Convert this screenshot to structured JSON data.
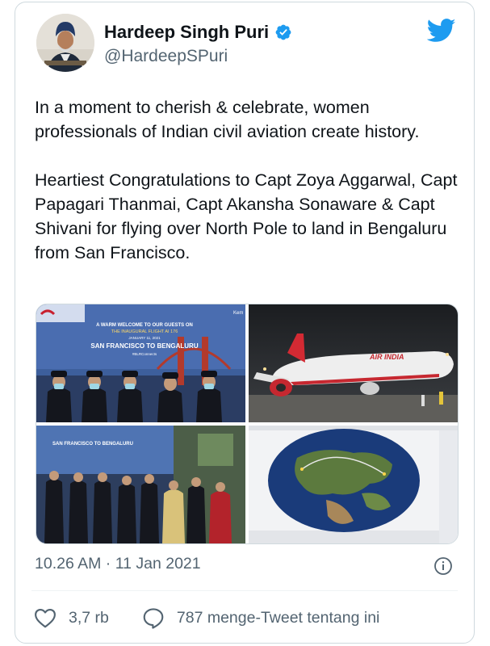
{
  "author": {
    "name": "Hardeep Singh Puri",
    "handle": "@HardeepSPuri"
  },
  "tweet": {
    "paragraph1": "In a moment to cherish & celebrate, women professionals of Indian civil aviation create history.",
    "paragraph2": "Heartiest Congratulations to Capt Zoya Aggarwal, Capt Papagari Thanmai, Capt Akansha Sonaware & Capt Shivani for flying over North Pole to land in Bengaluru from San Francisco."
  },
  "media": {
    "photo1": {
      "banner_line1": "A WARM WELCOME TO OUR GUESTS ON",
      "banner_line2": "THE INAUGURAL FLIGHT AI 176",
      "banner_date": "JANUARY 11, 2021",
      "banner_route": "SAN FRANCISCO TO BENGALURU",
      "banner_hashtag": "#BLRConnects",
      "corner_text": "Kem"
    },
    "photo2": {
      "airline_text": "AIR INDIA"
    },
    "photo3": {
      "banner_route": "SAN FRANCISCO TO BENGALURU"
    }
  },
  "timestamp": "10.26 AM · 11 Jan 2021",
  "actions": {
    "likes_count": "3,7 rb",
    "retweet_label": "787 menge-Tweet tentang ini"
  },
  "colors": {
    "twitter_blue": "#1d9bf0",
    "text_primary": "#0f1419",
    "text_secondary": "#536471",
    "border": "#cfd9de"
  },
  "icons": [
    "verified-badge-icon",
    "twitter-bird-icon",
    "info-icon",
    "heart-icon",
    "speech-bubble-icon"
  ]
}
